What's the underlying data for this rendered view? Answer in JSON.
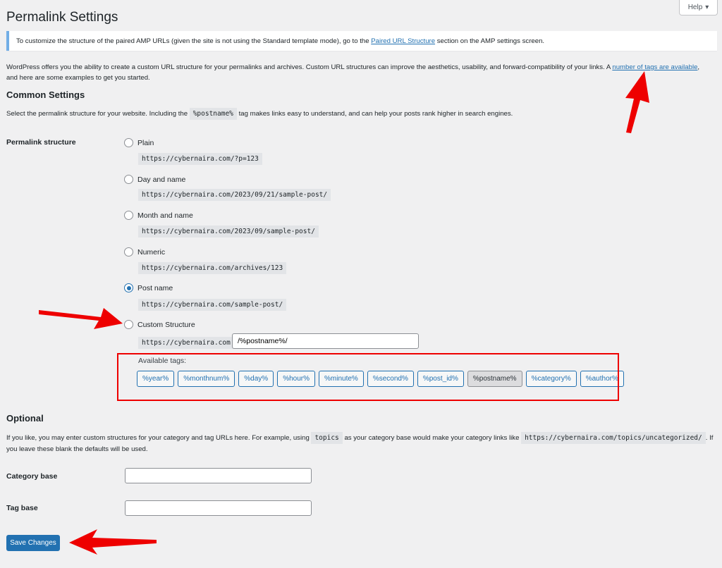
{
  "header": {
    "title": "Permalink Settings",
    "help_label": "Help"
  },
  "notice": {
    "text_before": "To customize the structure of the paired AMP URLs (given the site is not using the Standard template mode), go to the ",
    "link": "Paired URL Structure",
    "text_after": " section on the AMP settings screen."
  },
  "intro": {
    "text": "WordPress offers you the ability to create a custom URL structure for your permalinks and archives. Custom URL structures can improve the aesthetics, usability, and forward-compatibility of your links. A ",
    "link": "number of tags are available",
    "text_after": ",",
    "line2": "and here are some examples to get you started."
  },
  "common": {
    "heading": "Common Settings",
    "desc_before": "Select the permalink structure for your website. Including the ",
    "desc_code": "%postname%",
    "desc_after": " tag makes links easy to understand, and can help your posts rank higher in search engines.",
    "field_label": "Permalink structure",
    "options": [
      {
        "label": "Plain",
        "url": "https://cybernaira.com/?p=123"
      },
      {
        "label": "Day and name",
        "url": "https://cybernaira.com/2023/09/21/sample-post/"
      },
      {
        "label": "Month and name",
        "url": "https://cybernaira.com/2023/09/sample-post/"
      },
      {
        "label": "Numeric",
        "url": "https://cybernaira.com/archives/123"
      },
      {
        "label": "Post name",
        "url": "https://cybernaira.com/sample-post/"
      },
      {
        "label": "Custom Structure"
      }
    ],
    "selected_option": "Post name",
    "custom_prefix": "https://cybernaira.com",
    "custom_value": "/%postname%/",
    "available_tags_label": "Available tags:",
    "tags": [
      "%year%",
      "%monthnum%",
      "%day%",
      "%hour%",
      "%minute%",
      "%second%",
      "%post_id%",
      "%postname%",
      "%category%",
      "%author%"
    ],
    "active_tag": "%postname%"
  },
  "optional": {
    "heading": "Optional",
    "desc_before": "If you like, you may enter custom structures for your category and tag URLs here. For example, using ",
    "desc_code1": "topics",
    "desc_mid": " as your category base would make your category links like ",
    "desc_code2": "https://cybernaira.com/topics/uncategorized/",
    "desc_after": ". If",
    "desc_line2": "you leave these blank the defaults will be used.",
    "category_label": "Category base",
    "category_value": "",
    "tag_label": "Tag base",
    "tag_value": ""
  },
  "actions": {
    "save_label": "Save Changes"
  },
  "colors": {
    "accent": "#2271b1",
    "annotation": "#e00000",
    "notice_border": "#72aee6"
  }
}
